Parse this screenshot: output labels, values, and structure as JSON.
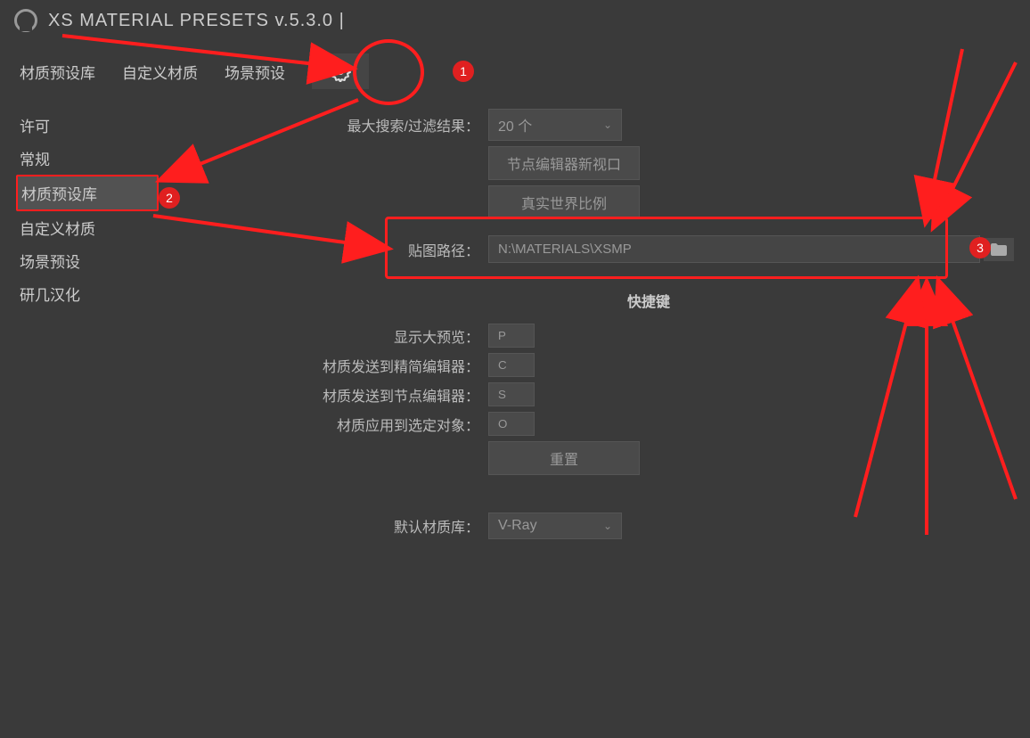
{
  "title": "XS MATERIAL PRESETS v.5.3.0 |",
  "tabs": {
    "presets": "材质预设库",
    "custom": "自定义材质",
    "scene": "场景预设"
  },
  "sidebar": [
    "许可",
    "常规",
    "材质预设库",
    "自定义材质",
    "场景预设",
    "研几汉化"
  ],
  "general": {
    "max_search_label": "最大搜索/过滤结果：",
    "max_search_value": "20 个",
    "node_viewport_btn": "节点编辑器新视口",
    "real_world_btn": "真实世界比例",
    "texture_path_label": "贴图路径：",
    "texture_path_value": "N:\\MATERIALS\\XSMP"
  },
  "shortcuts": {
    "title": "快捷键",
    "big_preview_label": "显示大预览：",
    "big_preview_key": "P",
    "send_compact_label": "材质发送到精简编辑器：",
    "send_compact_key": "C",
    "send_node_label": "材质发送到节点编辑器：",
    "send_node_key": "S",
    "apply_sel_label": "材质应用到选定对象：",
    "apply_sel_key": "O",
    "reset_btn": "重置"
  },
  "default_lib": {
    "label": "默认材质库：",
    "value": "V-Ray"
  },
  "badges": {
    "b1": "1",
    "b2": "2",
    "b3": "3"
  }
}
